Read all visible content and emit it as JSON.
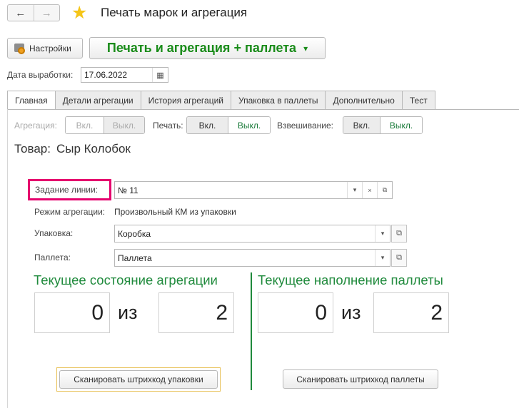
{
  "header": {
    "back_icon": "arrow-left",
    "forward_icon": "arrow-right",
    "back_glyph": "←",
    "forward_glyph": "→",
    "favorite_glyph": "★",
    "title": "Печать марок и агрегация"
  },
  "toolbar": {
    "settings_label": "Настройки",
    "print_label": "Печать и агрегация + паллета",
    "print_caret": "▾"
  },
  "date": {
    "label": "Дата выработки:",
    "value": "17.06.2022",
    "calendar_glyph": "▦"
  },
  "tabs": [
    {
      "label": "Главная",
      "active": true
    },
    {
      "label": "Детали агрегации"
    },
    {
      "label": "История агрегаций"
    },
    {
      "label": "Упаковка в паллеты"
    },
    {
      "label": "Дополнительно"
    },
    {
      "label": "Тест"
    }
  ],
  "modes": {
    "aggregation": {
      "label": "Агрегация:",
      "on": "Вкл.",
      "off": "Выкл.",
      "selected": "off",
      "disabled": true
    },
    "print": {
      "label": "Печать:",
      "on": "Вкл.",
      "off": "Выкл.",
      "selected": "off"
    },
    "weighing": {
      "label": "Взвешивание:",
      "on": "Вкл.",
      "off": "Выкл.",
      "selected": "off"
    }
  },
  "product": {
    "label": "Товар:",
    "value": "Сыр Колобок"
  },
  "form": {
    "line_task": {
      "label": "Задание линии:",
      "value": "№ 11"
    },
    "agg_mode": {
      "label": "Режим агрегации:",
      "value": "Произвольный КМ из упаковки"
    },
    "package": {
      "label": "Упаковка:",
      "value": "Коробка"
    },
    "pallet": {
      "label": "Паллета:",
      "value": "Паллета"
    },
    "dropdown_glyph": "▾",
    "clear_glyph": "×",
    "open_glyph": "⧉"
  },
  "aggregation_state": {
    "title": "Текущее состояние агрегации",
    "current": "0",
    "of": "из",
    "total": "2"
  },
  "pallet_state": {
    "title": "Текущее наполнение паллеты",
    "current": "0",
    "of": "из",
    "total": "2"
  },
  "actions": {
    "scan_package": "Сканировать штрихкод упаковки",
    "scan_pallet": "Сканировать штрихкод паллеты"
  },
  "colors": {
    "accent_green": "#1f8a3c",
    "highlight": "#e5006d",
    "favorite": "#f5c518"
  }
}
